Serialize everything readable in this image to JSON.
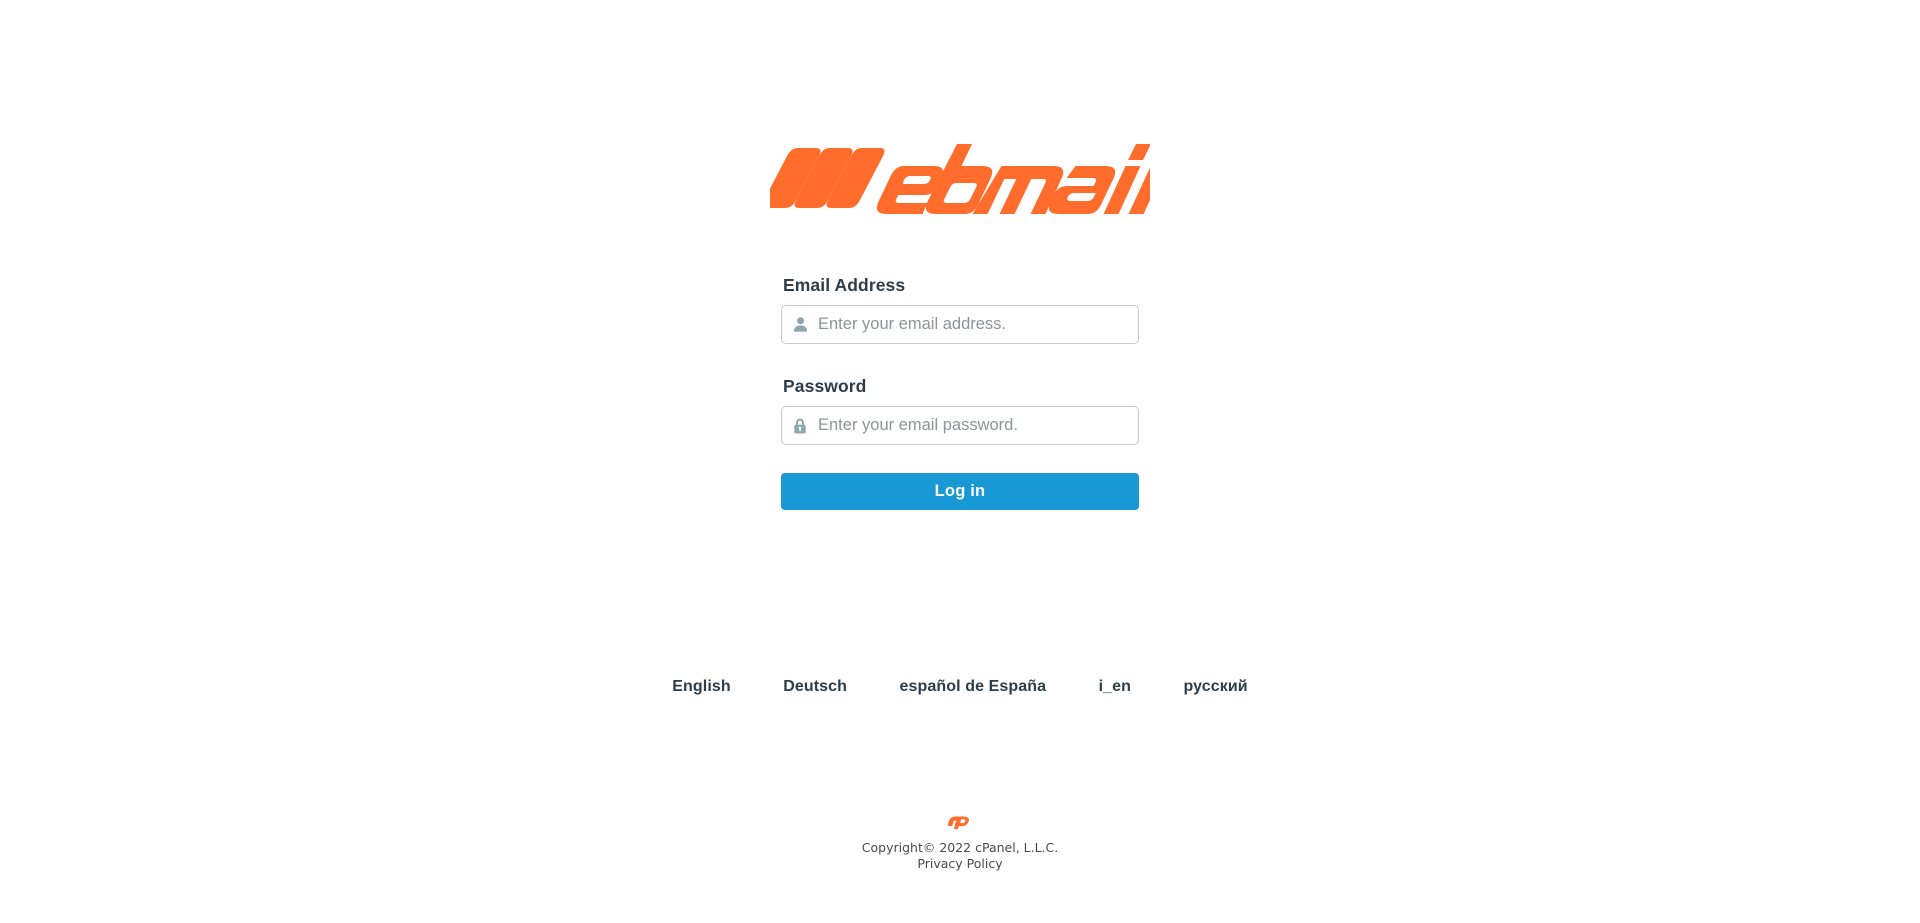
{
  "brand": {
    "logo_text": "Webmail",
    "logo_color": "#ff6c2c"
  },
  "form": {
    "email": {
      "label": "Email Address",
      "placeholder": "Enter your email address.",
      "value": "",
      "icon": "user-icon"
    },
    "password": {
      "label": "Password",
      "placeholder": "Enter your email password.",
      "value": "",
      "icon": "lock-icon"
    },
    "submit_label": "Log in",
    "submit_color": "#1899d6"
  },
  "locales": [
    {
      "label": "English"
    },
    {
      "label": "Deutsch"
    },
    {
      "label": "español de España"
    },
    {
      "label": "i_en"
    },
    {
      "label": "русский"
    }
  ],
  "footer": {
    "logo_icon": "cpanel-logo-icon",
    "copyright": "Copyright© 2022 cPanel, L.L.C.",
    "privacy_label": "Privacy Policy"
  }
}
